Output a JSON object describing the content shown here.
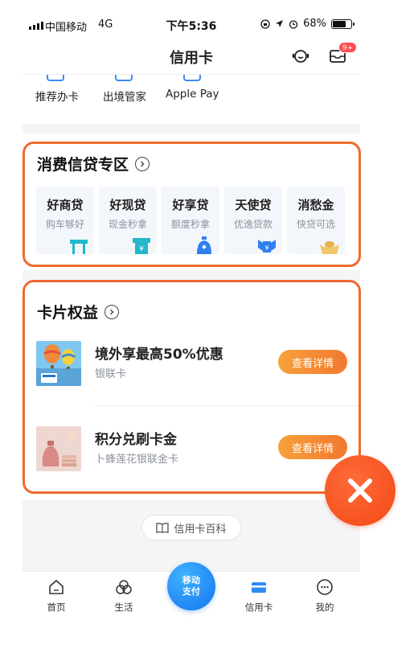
{
  "status_bar": {
    "carrier": "中国移动",
    "network": "4G",
    "time": "下午5:36",
    "battery": "68%"
  },
  "nav": {
    "title": "信用卡",
    "message_badge": "9+"
  },
  "shortcuts": [
    {
      "label": "推荐办卡"
    },
    {
      "label": "出境管家"
    },
    {
      "label": "Apple Pay"
    }
  ],
  "loan_section": {
    "title": "消费信贷专区",
    "items": [
      {
        "name": "好商贷",
        "sub": "购车够好",
        "icon": "shop-icon"
      },
      {
        "name": "好现贷",
        "sub": "现金秒拿",
        "icon": "atm-icon"
      },
      {
        "name": "好享贷",
        "sub": "额度秒拿",
        "icon": "bag-icon"
      },
      {
        "name": "天使贷",
        "sub": "优逸贷款",
        "icon": "wing-yuan-icon"
      },
      {
        "name": "消愁金",
        "sub": "快贷可选",
        "icon": "gold-ingot-icon"
      }
    ]
  },
  "benefit_section": {
    "title": "卡片权益",
    "items": [
      {
        "title": "境外享最高50%优惠",
        "sub": "银联卡",
        "button": "查看详情",
        "image": "hot-air-balloon-image"
      },
      {
        "title": "积分兑刷卡金",
        "sub": "卜蜂莲花银联金卡",
        "button": "查看详情",
        "image": "coin-bag-image"
      }
    ]
  },
  "wiki_button": {
    "label": "信用卡百科"
  },
  "tab_bar": {
    "tabs": [
      {
        "label": "首页"
      },
      {
        "label": "生活"
      },
      {
        "label": "信用卡"
      },
      {
        "label": "我的"
      }
    ],
    "pay_button": {
      "line1": "移动",
      "line2": "支付"
    }
  },
  "colors": {
    "accent_blue": "#1574f0",
    "highlight_orange": "#ef6a2e",
    "button_orange": "#f2782f",
    "close_fab": "#f24a15"
  }
}
